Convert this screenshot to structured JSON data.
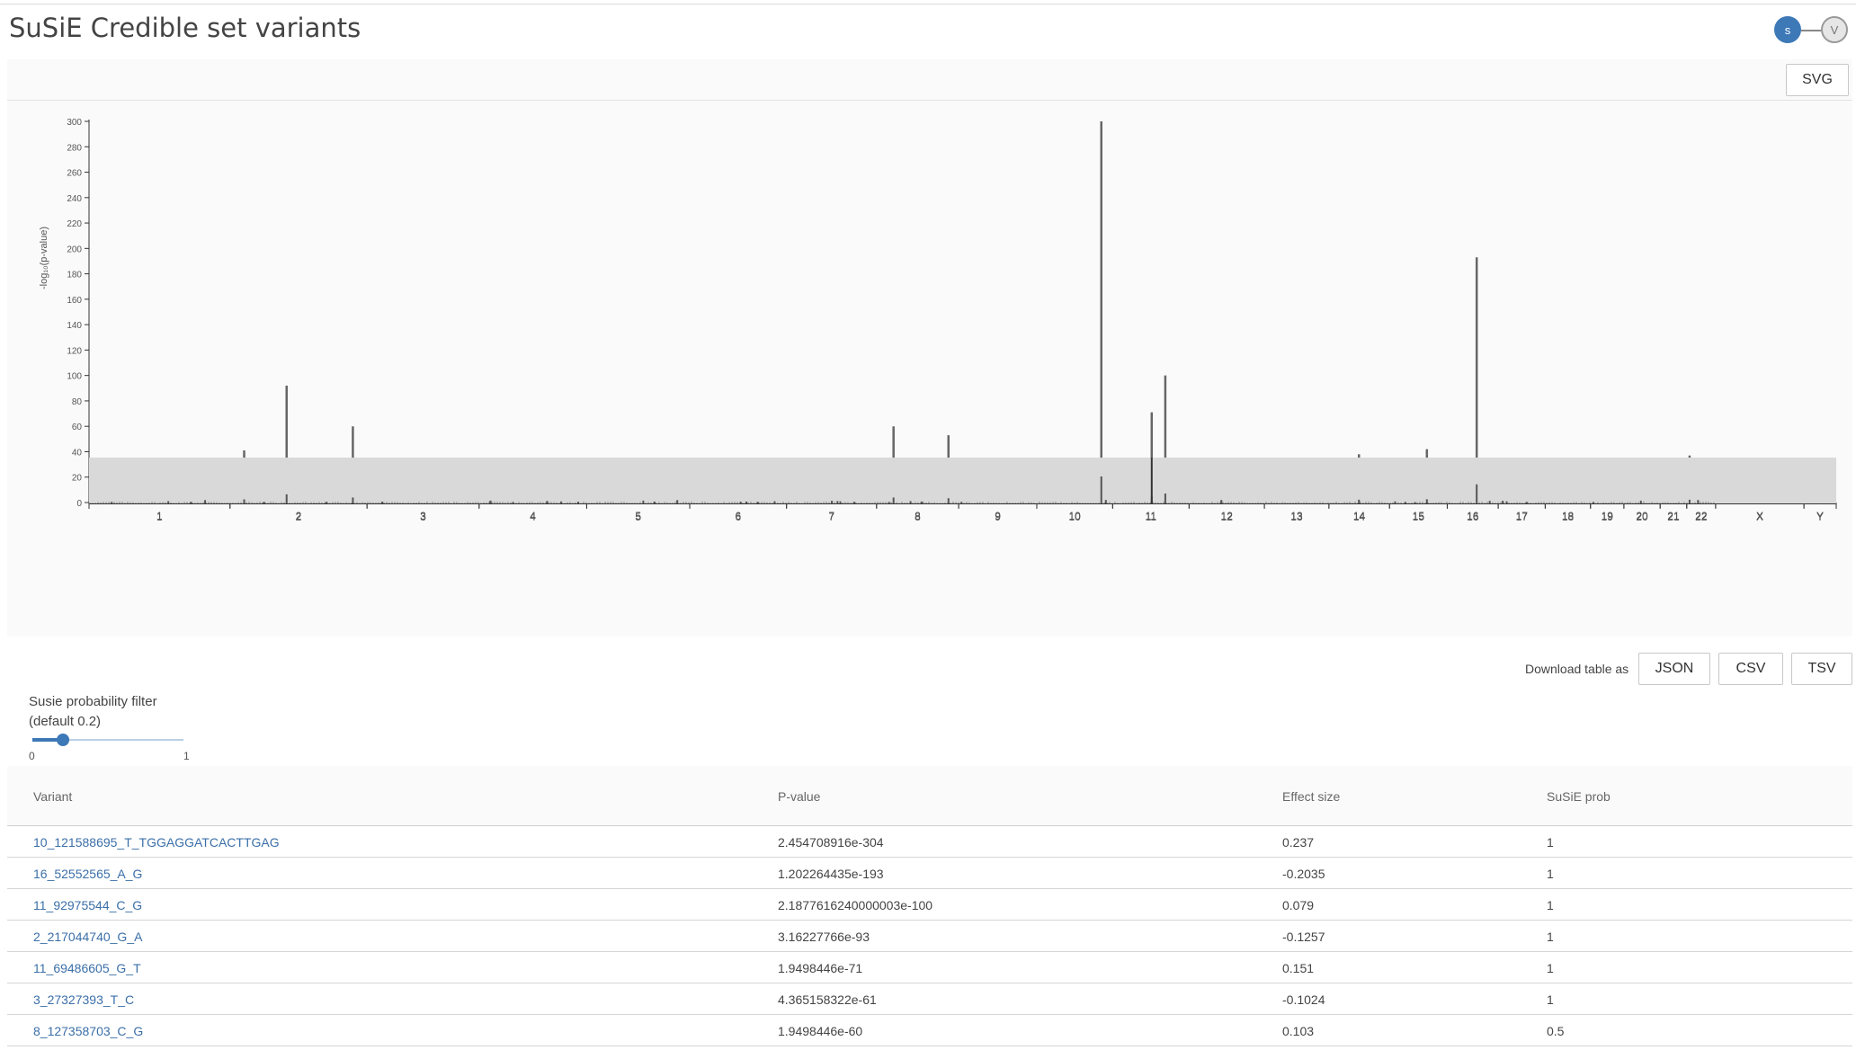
{
  "page": {
    "title": "SuSiE Credible set variants"
  },
  "stepper": {
    "step1": "s",
    "step2": "V"
  },
  "toolbar": {
    "svg_label": "SVG"
  },
  "download": {
    "label": "Download table as",
    "json": "JSON",
    "csv": "CSV",
    "tsv": "TSV"
  },
  "filter": {
    "title_line1": "Susie probability filter",
    "title_line2": "(default 0.2)",
    "min": "0",
    "max": "1",
    "value": 0.2
  },
  "table": {
    "columns": [
      "Variant",
      "P-value",
      "Effect size",
      "SuSiE prob"
    ],
    "rows": [
      {
        "variant": "10_121588695_T_TGGAGGATCACTTGAG",
        "pvalue": "2.454708916e-304",
        "effect": "0.237",
        "prob": "1"
      },
      {
        "variant": "16_52552565_A_G",
        "pvalue": "1.202264435e-193",
        "effect": "-0.2035",
        "prob": "1"
      },
      {
        "variant": "11_92975544_C_G",
        "pvalue": "2.1877616240000003e-100",
        "effect": "0.079",
        "prob": "1"
      },
      {
        "variant": "2_217044740_G_A",
        "pvalue": "3.16227766e-93",
        "effect": "-0.1257",
        "prob": "1"
      },
      {
        "variant": "11_69486605_G_T",
        "pvalue": "1.9498446e-71",
        "effect": "0.151",
        "prob": "1"
      },
      {
        "variant": "3_27327393_T_C",
        "pvalue": "4.365158322e-61",
        "effect": "-0.1024",
        "prob": "1"
      },
      {
        "variant": "8_127358703_C_G",
        "pvalue": "1.9498446e-60",
        "effect": "0.103",
        "prob": "0.5"
      }
    ]
  },
  "chart_data": {
    "type": "bar",
    "title": "",
    "ylabel": "-log₁₀(p-value)",
    "xlabel": "",
    "ylim": [
      0,
      300
    ],
    "yticks": [
      0,
      20,
      40,
      60,
      80,
      100,
      120,
      140,
      160,
      180,
      200,
      220,
      240,
      260,
      280,
      300
    ],
    "significance_line": 7.3,
    "significance_color": "#e07060",
    "bar_color": "#666666",
    "chromosomes": [
      "1",
      "2",
      "3",
      "4",
      "5",
      "6",
      "7",
      "8",
      "9",
      "10",
      "11",
      "12",
      "13",
      "14",
      "15",
      "16",
      "17",
      "18",
      "19",
      "20",
      "21",
      "22",
      "X",
      "Y"
    ],
    "chromosome_lengths_mb": [
      249,
      242,
      198,
      190,
      182,
      171,
      159,
      145,
      138,
      134,
      135,
      133,
      114,
      107,
      102,
      90,
      83,
      80,
      59,
      64,
      47,
      51,
      156,
      57
    ],
    "peaks": [
      {
        "chr": "1",
        "pos": 40,
        "y": 16
      },
      {
        "chr": "1",
        "pos": 140,
        "y": 23
      },
      {
        "chr": "1",
        "pos": 180,
        "y": 17
      },
      {
        "chr": "1",
        "pos": 205,
        "y": 34
      },
      {
        "chr": "2",
        "pos": 25,
        "y": 41
      },
      {
        "chr": "2",
        "pos": 60,
        "y": 16
      },
      {
        "chr": "2",
        "pos": 100,
        "y": 92
      },
      {
        "chr": "2",
        "pos": 170,
        "y": 16
      },
      {
        "chr": "2",
        "pos": 217,
        "y": 60
      },
      {
        "chr": "3",
        "pos": 27,
        "y": 18
      },
      {
        "chr": "4",
        "pos": 20,
        "y": 29
      },
      {
        "chr": "4",
        "pos": 60,
        "y": 15
      },
      {
        "chr": "4",
        "pos": 120,
        "y": 25
      },
      {
        "chr": "4",
        "pos": 145,
        "y": 20
      },
      {
        "chr": "4",
        "pos": 175,
        "y": 18
      },
      {
        "chr": "5",
        "pos": 100,
        "y": 28
      },
      {
        "chr": "5",
        "pos": 120,
        "y": 18
      },
      {
        "chr": "5",
        "pos": 160,
        "y": 34
      },
      {
        "chr": "6",
        "pos": 90,
        "y": 18
      },
      {
        "chr": "6",
        "pos": 100,
        "y": 19
      },
      {
        "chr": "6",
        "pos": 120,
        "y": 17
      },
      {
        "chr": "6",
        "pos": 150,
        "y": 22
      },
      {
        "chr": "7",
        "pos": 80,
        "y": 27
      },
      {
        "chr": "7",
        "pos": 90,
        "y": 24
      },
      {
        "chr": "7",
        "pos": 95,
        "y": 21
      },
      {
        "chr": "7",
        "pos": 120,
        "y": 16
      },
      {
        "chr": "8",
        "pos": 22,
        "y": 15
      },
      {
        "chr": "8",
        "pos": 30,
        "y": 60
      },
      {
        "chr": "8",
        "pos": 60,
        "y": 23
      },
      {
        "chr": "8",
        "pos": 80,
        "y": 19
      },
      {
        "chr": "8",
        "pos": 127,
        "y": 53
      },
      {
        "chr": "9",
        "pos": 5,
        "y": 16
      },
      {
        "chr": "10",
        "pos": 114,
        "y": 300
      },
      {
        "chr": "10",
        "pos": 122,
        "y": 35
      },
      {
        "chr": "11",
        "pos": 69,
        "y": 71
      },
      {
        "chr": "11",
        "pos": 93,
        "y": 100
      },
      {
        "chr": "12",
        "pos": 57,
        "y": 35
      },
      {
        "chr": "14",
        "pos": 53,
        "y": 38
      },
      {
        "chr": "15",
        "pos": 10,
        "y": 20
      },
      {
        "chr": "15",
        "pos": 28,
        "y": 16
      },
      {
        "chr": "15",
        "pos": 45,
        "y": 14
      },
      {
        "chr": "15",
        "pos": 66,
        "y": 42
      },
      {
        "chr": "16",
        "pos": 52,
        "y": 193
      },
      {
        "chr": "16",
        "pos": 75,
        "y": 26
      },
      {
        "chr": "17",
        "pos": 8,
        "y": 27
      },
      {
        "chr": "17",
        "pos": 15,
        "y": 21
      },
      {
        "chr": "17",
        "pos": 50,
        "y": 15
      },
      {
        "chr": "19",
        "pos": 5,
        "y": 15
      },
      {
        "chr": "20",
        "pos": 30,
        "y": 28
      },
      {
        "chr": "22",
        "pos": 5,
        "y": 37
      },
      {
        "chr": "22",
        "pos": 20,
        "y": 34
      }
    ],
    "brush_highlight": {
      "chr": "11",
      "pos": 69,
      "y": 71
    }
  }
}
